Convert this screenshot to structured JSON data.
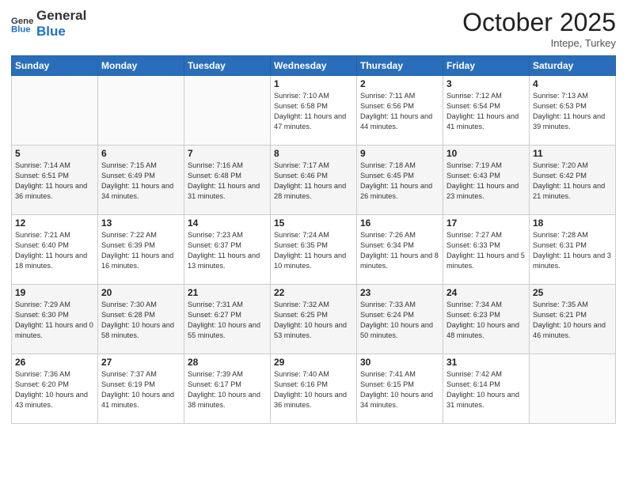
{
  "header": {
    "logo_line1": "General",
    "logo_line2": "Blue",
    "month": "October 2025",
    "location": "Intepe, Turkey"
  },
  "weekdays": [
    "Sunday",
    "Monday",
    "Tuesday",
    "Wednesday",
    "Thursday",
    "Friday",
    "Saturday"
  ],
  "weeks": [
    [
      {
        "day": "",
        "info": ""
      },
      {
        "day": "",
        "info": ""
      },
      {
        "day": "",
        "info": ""
      },
      {
        "day": "1",
        "info": "Sunrise: 7:10 AM\nSunset: 6:58 PM\nDaylight: 11 hours and 47 minutes."
      },
      {
        "day": "2",
        "info": "Sunrise: 7:11 AM\nSunset: 6:56 PM\nDaylight: 11 hours and 44 minutes."
      },
      {
        "day": "3",
        "info": "Sunrise: 7:12 AM\nSunset: 6:54 PM\nDaylight: 11 hours and 41 minutes."
      },
      {
        "day": "4",
        "info": "Sunrise: 7:13 AM\nSunset: 6:53 PM\nDaylight: 11 hours and 39 minutes."
      }
    ],
    [
      {
        "day": "5",
        "info": "Sunrise: 7:14 AM\nSunset: 6:51 PM\nDaylight: 11 hours and 36 minutes."
      },
      {
        "day": "6",
        "info": "Sunrise: 7:15 AM\nSunset: 6:49 PM\nDaylight: 11 hours and 34 minutes."
      },
      {
        "day": "7",
        "info": "Sunrise: 7:16 AM\nSunset: 6:48 PM\nDaylight: 11 hours and 31 minutes."
      },
      {
        "day": "8",
        "info": "Sunrise: 7:17 AM\nSunset: 6:46 PM\nDaylight: 11 hours and 28 minutes."
      },
      {
        "day": "9",
        "info": "Sunrise: 7:18 AM\nSunset: 6:45 PM\nDaylight: 11 hours and 26 minutes."
      },
      {
        "day": "10",
        "info": "Sunrise: 7:19 AM\nSunset: 6:43 PM\nDaylight: 11 hours and 23 minutes."
      },
      {
        "day": "11",
        "info": "Sunrise: 7:20 AM\nSunset: 6:42 PM\nDaylight: 11 hours and 21 minutes."
      }
    ],
    [
      {
        "day": "12",
        "info": "Sunrise: 7:21 AM\nSunset: 6:40 PM\nDaylight: 11 hours and 18 minutes."
      },
      {
        "day": "13",
        "info": "Sunrise: 7:22 AM\nSunset: 6:39 PM\nDaylight: 11 hours and 16 minutes."
      },
      {
        "day": "14",
        "info": "Sunrise: 7:23 AM\nSunset: 6:37 PM\nDaylight: 11 hours and 13 minutes."
      },
      {
        "day": "15",
        "info": "Sunrise: 7:24 AM\nSunset: 6:35 PM\nDaylight: 11 hours and 10 minutes."
      },
      {
        "day": "16",
        "info": "Sunrise: 7:26 AM\nSunset: 6:34 PM\nDaylight: 11 hours and 8 minutes."
      },
      {
        "day": "17",
        "info": "Sunrise: 7:27 AM\nSunset: 6:33 PM\nDaylight: 11 hours and 5 minutes."
      },
      {
        "day": "18",
        "info": "Sunrise: 7:28 AM\nSunset: 6:31 PM\nDaylight: 11 hours and 3 minutes."
      }
    ],
    [
      {
        "day": "19",
        "info": "Sunrise: 7:29 AM\nSunset: 6:30 PM\nDaylight: 11 hours and 0 minutes."
      },
      {
        "day": "20",
        "info": "Sunrise: 7:30 AM\nSunset: 6:28 PM\nDaylight: 10 hours and 58 minutes."
      },
      {
        "day": "21",
        "info": "Sunrise: 7:31 AM\nSunset: 6:27 PM\nDaylight: 10 hours and 55 minutes."
      },
      {
        "day": "22",
        "info": "Sunrise: 7:32 AM\nSunset: 6:25 PM\nDaylight: 10 hours and 53 minutes."
      },
      {
        "day": "23",
        "info": "Sunrise: 7:33 AM\nSunset: 6:24 PM\nDaylight: 10 hours and 50 minutes."
      },
      {
        "day": "24",
        "info": "Sunrise: 7:34 AM\nSunset: 6:23 PM\nDaylight: 10 hours and 48 minutes."
      },
      {
        "day": "25",
        "info": "Sunrise: 7:35 AM\nSunset: 6:21 PM\nDaylight: 10 hours and 46 minutes."
      }
    ],
    [
      {
        "day": "26",
        "info": "Sunrise: 7:36 AM\nSunset: 6:20 PM\nDaylight: 10 hours and 43 minutes."
      },
      {
        "day": "27",
        "info": "Sunrise: 7:37 AM\nSunset: 6:19 PM\nDaylight: 10 hours and 41 minutes."
      },
      {
        "day": "28",
        "info": "Sunrise: 7:39 AM\nSunset: 6:17 PM\nDaylight: 10 hours and 38 minutes."
      },
      {
        "day": "29",
        "info": "Sunrise: 7:40 AM\nSunset: 6:16 PM\nDaylight: 10 hours and 36 minutes."
      },
      {
        "day": "30",
        "info": "Sunrise: 7:41 AM\nSunset: 6:15 PM\nDaylight: 10 hours and 34 minutes."
      },
      {
        "day": "31",
        "info": "Sunrise: 7:42 AM\nSunset: 6:14 PM\nDaylight: 10 hours and 31 minutes."
      },
      {
        "day": "",
        "info": ""
      }
    ]
  ]
}
